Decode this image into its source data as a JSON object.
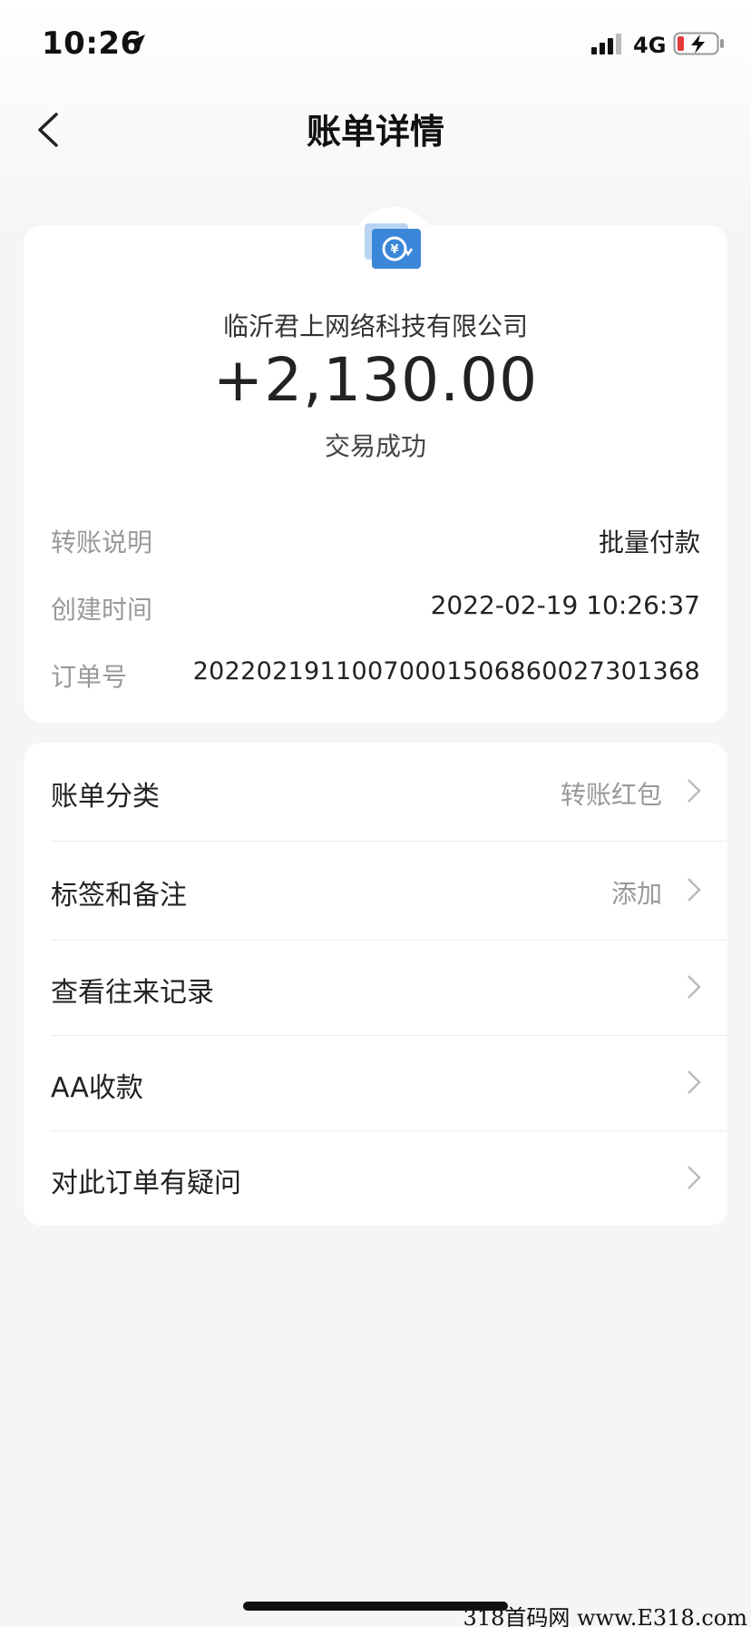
{
  "status_bar": {
    "time": "10:26",
    "network": "4G"
  },
  "nav": {
    "title": "账单详情"
  },
  "summary": {
    "merchant_name": "临沂君上网络科技有限公司",
    "amount": "+2,130.00",
    "status": "交易成功",
    "details": [
      {
        "label": "转账说明",
        "value": "批量付款"
      },
      {
        "label": "创建时间",
        "value": "2022-02-19 10:26:37"
      },
      {
        "label": "订单号",
        "value": "20220219110070001506860027301368"
      }
    ]
  },
  "actions": [
    {
      "label": "账单分类",
      "value": "转账红包"
    },
    {
      "label": "标签和备注",
      "value": "添加"
    },
    {
      "label": "查看往来记录",
      "value": ""
    },
    {
      "label": "AA收款",
      "value": ""
    },
    {
      "label": "对此订单有疑问",
      "value": ""
    }
  ],
  "watermark": "318首码网  www.E318.com",
  "colors": {
    "background": "#f5f5f7",
    "card": "#ffffff",
    "logo_blue": "#3a86d8",
    "battery_red": "#e33b3b"
  }
}
